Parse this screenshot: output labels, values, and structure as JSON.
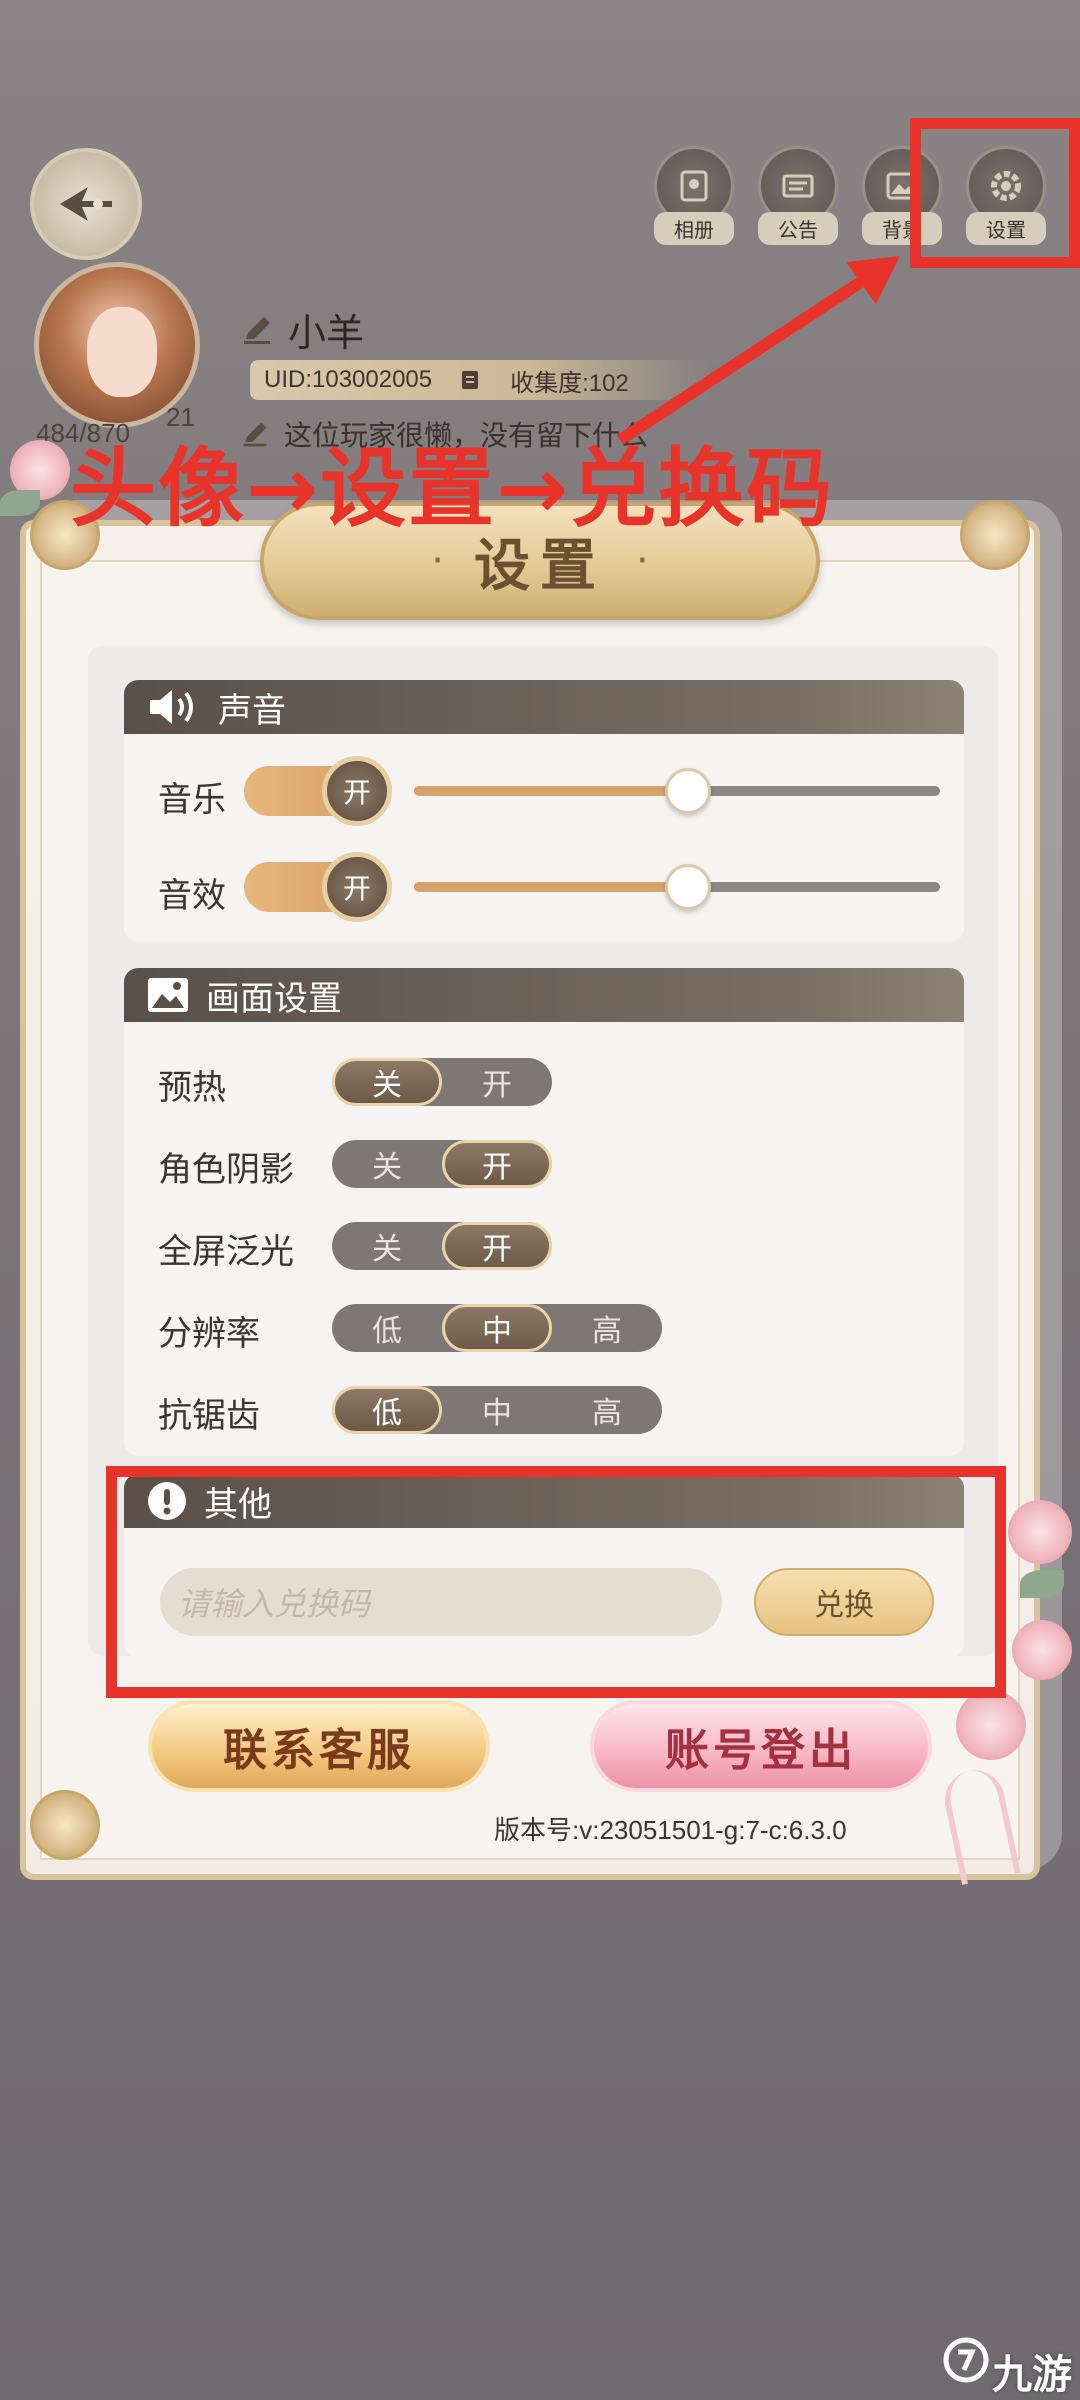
{
  "top_icons": [
    {
      "label": "相册",
      "icon": "album-icon"
    },
    {
      "label": "公告",
      "icon": "notice-icon"
    },
    {
      "label": "背景",
      "icon": "background-icon"
    },
    {
      "label": "设置",
      "icon": "gear-icon"
    }
  ],
  "profile": {
    "name": "小羊",
    "uid": "UID:103002005",
    "collection": "收集度:102",
    "signature": "这位玩家很懒，没有留下什么",
    "exp": "484/870",
    "level": "21"
  },
  "instruction": "头像→设置→兑换码",
  "dialog": {
    "title": "设置",
    "sound": {
      "header": "声音",
      "music_label": "音乐",
      "music_toggle": "开",
      "music_level": 0.52,
      "sfx_label": "音效",
      "sfx_toggle": "开",
      "sfx_level": 0.52
    },
    "graphics": {
      "header": "画面设置",
      "rows": [
        {
          "label": "预热",
          "options": [
            "关",
            "开"
          ],
          "selected": 0
        },
        {
          "label": "角色阴影",
          "options": [
            "关",
            "开"
          ],
          "selected": 1
        },
        {
          "label": "全屏泛光",
          "options": [
            "关",
            "开"
          ],
          "selected": 1
        },
        {
          "label": "分辨率",
          "options": [
            "低",
            "中",
            "高"
          ],
          "selected": 1
        },
        {
          "label": "抗锯齿",
          "options": [
            "低",
            "中",
            "高"
          ],
          "selected": 0
        }
      ]
    },
    "other": {
      "header": "其他",
      "redeem_placeholder": "请输入兑换码",
      "redeem_button": "兑换"
    },
    "service_button": "联系客服",
    "logout_button": "账号登出",
    "version": "版本号:v:23051501-g:7-c:6.3.0"
  },
  "watermark": "九游",
  "colors": {
    "annotation_red": "#e8332a",
    "accent_gold": "#d4a36a",
    "section_header": "#5a5048"
  }
}
